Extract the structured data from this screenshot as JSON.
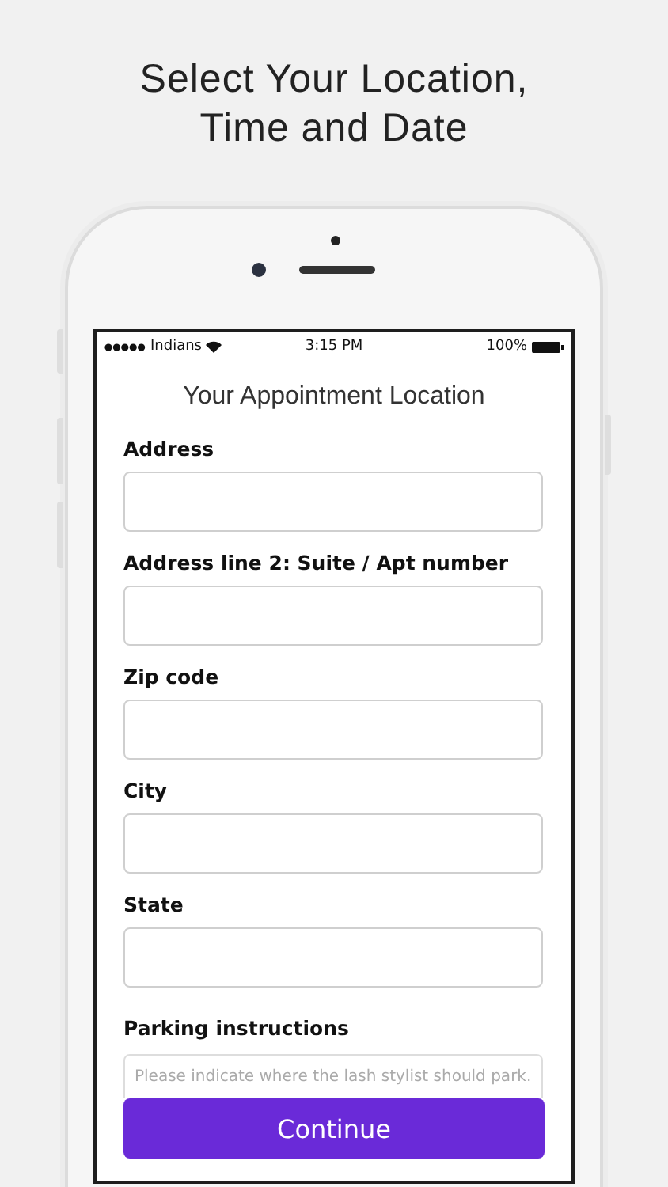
{
  "headline": [
    "Select Your Location,",
    "Time and Date"
  ],
  "status_bar": {
    "carrier": "Indians",
    "time": "3:15 PM",
    "battery": "100%"
  },
  "title": "Your Appointment Location",
  "fields": [
    {
      "kind": "input",
      "label": "Address"
    },
    {
      "kind": "input",
      "label": "Address line 2: Suite / Apt number"
    },
    {
      "kind": "input",
      "label": "Zip code"
    },
    {
      "kind": "input",
      "label": "City"
    },
    {
      "kind": "input",
      "label": "State"
    },
    {
      "kind": "textarea",
      "label": "Parking instructions",
      "placeholder": "Please indicate where the lash stylist should park."
    }
  ],
  "button": "Continue"
}
